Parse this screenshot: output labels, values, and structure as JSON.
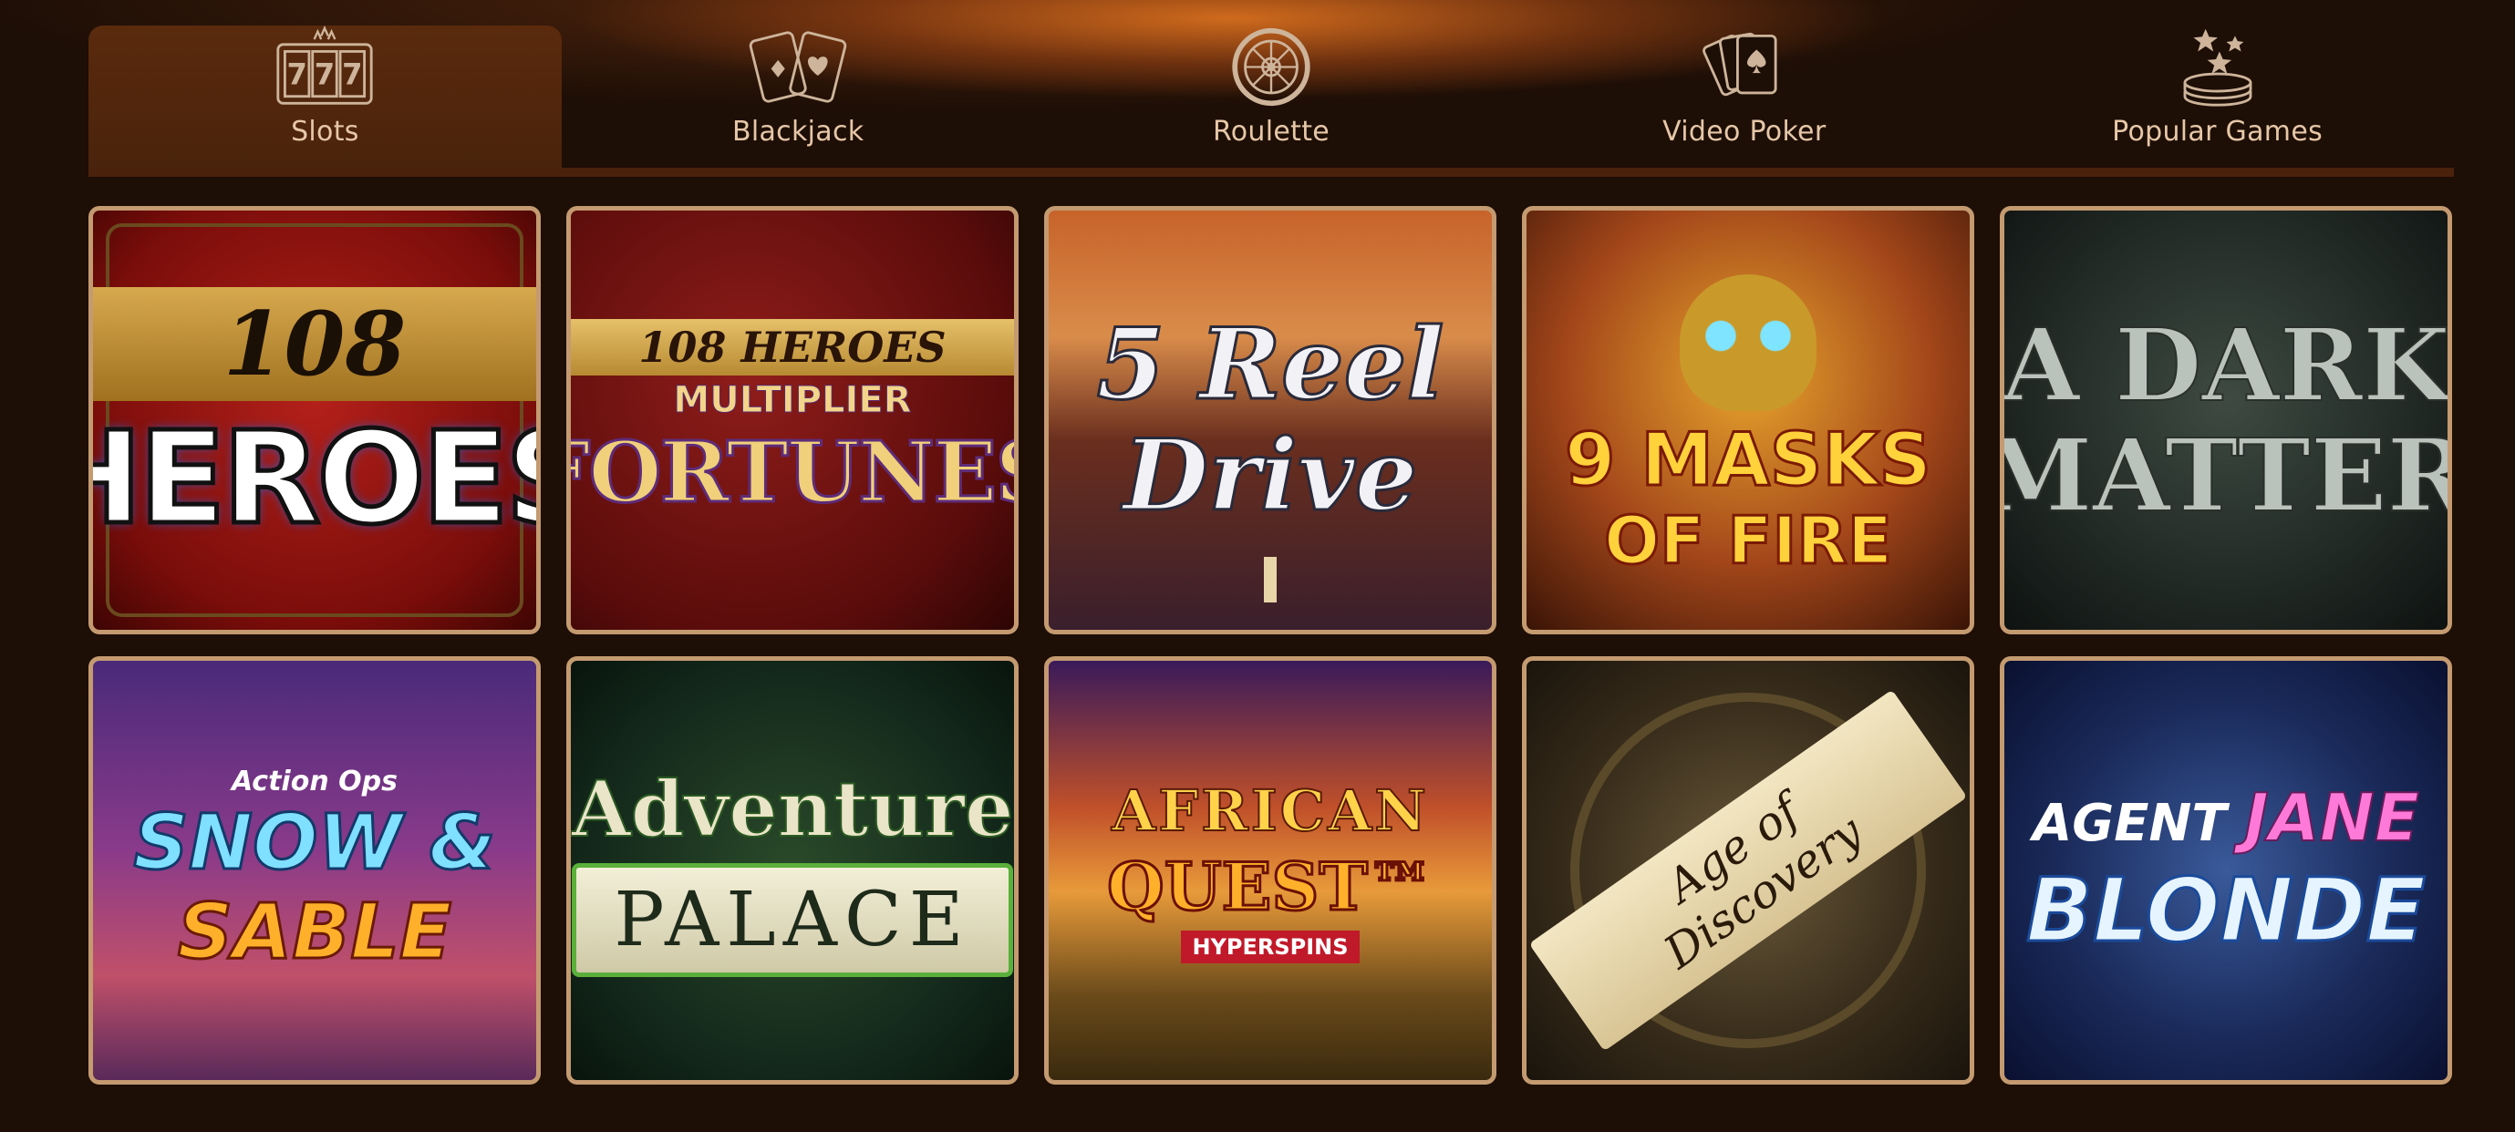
{
  "tabs": [
    {
      "label": "Slots",
      "icon": "slot-machine-icon",
      "active": true
    },
    {
      "label": "Blackjack",
      "icon": "playing-cards-icon",
      "active": false
    },
    {
      "label": "Roulette",
      "icon": "roulette-wheel-icon",
      "active": false
    },
    {
      "label": "Video Poker",
      "icon": "poker-cards-icon",
      "active": false
    },
    {
      "label": "Popular Games",
      "icon": "star-chips-icon",
      "active": false
    }
  ],
  "games": [
    {
      "line1": "108",
      "line2": "HEROES"
    },
    {
      "line1": "108 HEROES",
      "line2": "MULTIPLIER",
      "line3": "FORTUNES"
    },
    {
      "line1": "5 Reel",
      "line2": "Drive"
    },
    {
      "line1": "9 MASKS",
      "line2": "OF FIRE"
    },
    {
      "line1": "A DARK",
      "line2": "MATTER"
    },
    {
      "line1": "Action Ops",
      "line2": "SNOW &",
      "line3": "SABLE"
    },
    {
      "line1": "Adventure",
      "line2": "PALACE"
    },
    {
      "line1": "AFRICAN",
      "line2": "QUEST™",
      "line3": "HYPERSPINS"
    },
    {
      "line1": "Age of Discovery"
    },
    {
      "line1a": "AGENT",
      "line1b": "JANE",
      "line2": "BLONDE"
    }
  ],
  "colors": {
    "background": "#1d0e06",
    "active_tab": "#5a2a0d",
    "tile_border": "#c49a70",
    "tab_text": "#e6c7a7"
  }
}
